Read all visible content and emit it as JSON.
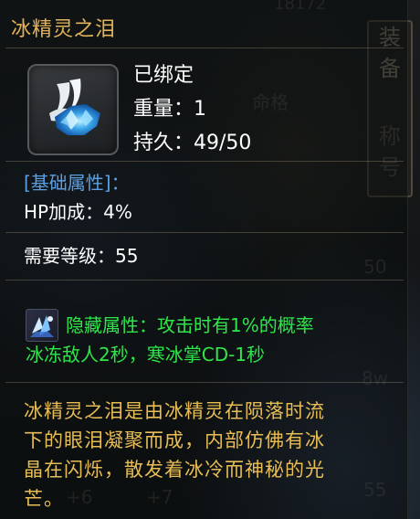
{
  "background": {
    "top_number": "18172",
    "side_tab_chars": [
      "装",
      "备",
      "称",
      "号"
    ],
    "mid_label": "命格",
    "bottom_numbers": [
      "+6",
      "+7"
    ],
    "right_numbers": [
      "50",
      "8w",
      "55"
    ]
  },
  "tooltip": {
    "item_name": "冰精灵之泪",
    "bound_status": "已绑定",
    "weight": "重量：1",
    "durability": "持久：49/50",
    "base_attr_header": "[基础属性]：",
    "hp_bonus": "HP加成：4%",
    "required_level": "需要等级：55",
    "hidden_attr_line1": "隐藏属性：攻击时有1%的概率",
    "hidden_attr_line2": "冰冻敌人2秒，寒冰掌CD-1秒",
    "description_line1": "冰精灵之泪是由冰精灵在陨落时流",
    "description_line2": "下的眼泪凝聚而成，内部仿佛有冰",
    "description_line3": "晶在闪烁，散发着冰冷而神秘的光",
    "description_line4": "芒。"
  },
  "colors": {
    "title": "#e3b35a",
    "attribute_header": "#5c9fe0",
    "hidden_attribute": "#2fe64a",
    "description": "#e8bd55",
    "stat_text": "#ffffff"
  },
  "icons": {
    "item": "ice-crystal-tear-icon",
    "hidden_attribute": "ice-shard-icon"
  }
}
